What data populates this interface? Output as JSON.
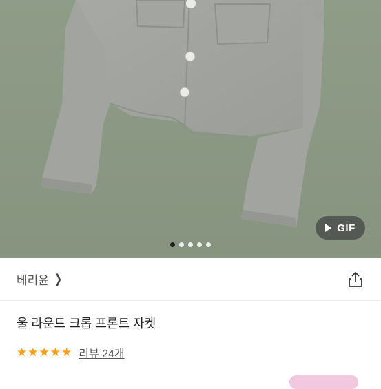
{
  "hero": {
    "gif_label": "GIF",
    "carousel": {
      "total": 5,
      "active": 1
    }
  },
  "shop": {
    "name": "베리윤"
  },
  "product": {
    "title": "울 라운드 크롭 프론트 자켓",
    "rating": 5,
    "reviews_label": "리뷰 24개"
  },
  "colors": {
    "star": "#ff9f1a",
    "hero_bg": "#8d9a85"
  },
  "icons": {
    "share": "share-icon",
    "chevron": "chevron-right-icon",
    "play": "play-icon"
  }
}
